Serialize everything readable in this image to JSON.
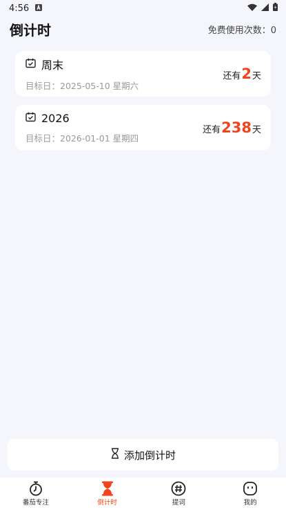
{
  "status_bar": {
    "time": "4:56",
    "icons": [
      "notification-a-icon",
      "wifi-icon",
      "signal-icon",
      "battery-icon"
    ]
  },
  "header": {
    "title": "倒计时",
    "usage_label": "免费使用次数：",
    "usage_count": "0"
  },
  "accent_color": "#F0441E",
  "countdowns": [
    {
      "name": "周末",
      "target_label": "目标日：",
      "target_date": "2025-05-10",
      "weekday": "星期六",
      "prefix": "还有",
      "days": "2",
      "suffix": "天",
      "icon": "calendar-check-icon"
    },
    {
      "name": "2026",
      "target_label": "目标日：",
      "target_date": "2026-01-01",
      "weekday": "星期四",
      "prefix": "还有",
      "days": "238",
      "suffix": "天",
      "icon": "calendar-check-icon"
    }
  ],
  "add_button": {
    "label": "添加倒计时",
    "icon": "hourglass-icon"
  },
  "nav": {
    "active_index": 1,
    "items": [
      {
        "label": "番茄专注",
        "icon": "stopwatch-icon"
      },
      {
        "label": "倒计时",
        "icon": "hourglass-icon"
      },
      {
        "label": "提词",
        "icon": "hashtag-icon"
      },
      {
        "label": "我的",
        "icon": "face-icon"
      }
    ]
  }
}
